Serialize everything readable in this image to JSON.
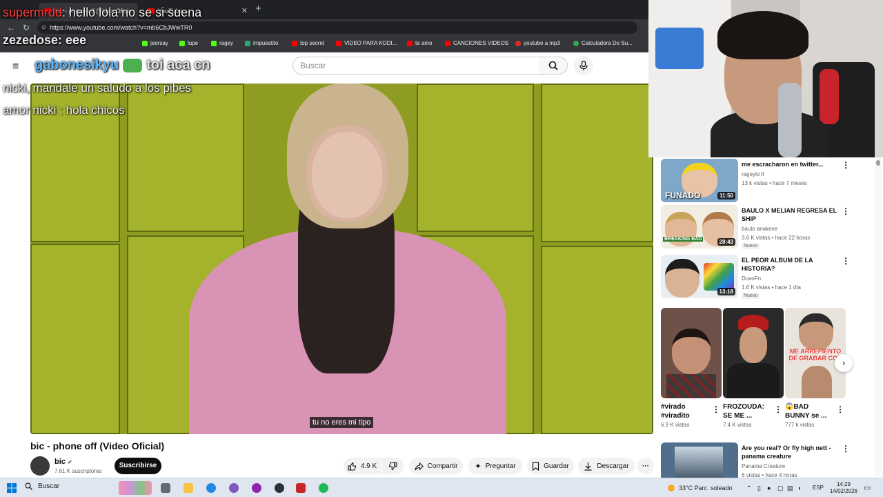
{
  "browser": {
    "tabs": [
      {
        "label": "bic - phone off (Video Oficial)"
      },
      {
        "label": "YouTube"
      }
    ],
    "new_tab": "+",
    "url": "https://www.youtube.com/watch?v=mb6CbJWwTR0",
    "bookmarks": [
      {
        "label": "jeersay",
        "color": "#53fc18"
      },
      {
        "label": "lupe",
        "color": "#53fc18"
      },
      {
        "label": "ragey",
        "color": "#53fc18"
      },
      {
        "label": "impuestito",
        "color": "#2aa876"
      },
      {
        "label": "top secret",
        "color": "#ff0000"
      },
      {
        "label": "VIDEO PARA KODI...",
        "color": "#ff0000"
      },
      {
        "label": "te amo",
        "color": "#ff0000"
      },
      {
        "label": "CANCIONES VIDEOS",
        "color": "#ff0000"
      },
      {
        "label": "youtube a mp3",
        "color": "#d93025"
      },
      {
        "label": "Calculadora De Su...",
        "color": "#34a853"
      }
    ]
  },
  "overlay_chat": [
    {
      "user": "supermrdd",
      "message": ": hello lola no se si suena"
    },
    {
      "user": "zezedose",
      "message": ": eee"
    },
    {
      "user": "gabonesikyu",
      "message": "toi aca cn"
    },
    {
      "user": "nicki",
      "message": ", mandale un saludo a los pibes"
    },
    {
      "user": "amor nicki",
      "message": " : hola chicos"
    }
  ],
  "youtube": {
    "search_placeholder": "Buscar",
    "video": {
      "subtitle": "tu no eres mi tipo",
      "title": "bic - phone off (Video Oficial)",
      "channel": "bic",
      "subscribers": "7.61 K suscriptores",
      "subscribe_label": "Suscribirse",
      "likes": "4.9 K",
      "share_label": "Compartir",
      "ask_label": "Preguntar",
      "save_label": "Guardar",
      "download_label": "Descargar",
      "more_label": "···"
    },
    "recommendations": [
      {
        "title": "me escracharon en twitter...",
        "channel": "rageylo fr",
        "meta": "13 k vistas • hace 7 meses",
        "duration": "11:50",
        "badge": "",
        "thumb_text": "FUNADO"
      },
      {
        "title": "BAULO X MELIAN REGRESA EL SHIP",
        "channel": "baulo anakeve",
        "meta": "3.6 K vistas • hace 22 horas",
        "duration": "28:43",
        "badge": "Nuevo",
        "thumb_text": "BREAKING BAD"
      },
      {
        "title": "EL PEOR ALBUM DE LA HISTORIA?",
        "channel": "DuvoFn",
        "meta": "1.6 K vistas • hace 1 día",
        "duration": "13:18",
        "badge": "Nuevo",
        "thumb_text": ""
      }
    ],
    "shorts": [
      {
        "title": "#virado #viradito",
        "views": "6.9 K vistas"
      },
      {
        "title": "FROZOUDA: SE ME ...",
        "views": "7.4 K vistas"
      },
      {
        "title": "😱BAD BUNNY se ...",
        "views": "777 k vistas",
        "thumb_text": "ME ARREPIENTO DE GRABAR CON"
      }
    ],
    "bottom_rec": {
      "title": "Are you real? Or fly high nett - panama creature",
      "channel": "Panama Creature",
      "meta": "6 vistas • hace 4 horas"
    }
  },
  "taskbar": {
    "search_label": "Buscar",
    "weather": "33°C  Parc. soleado",
    "language": "ESP",
    "time": "14:29",
    "date": "14/02/2026"
  }
}
